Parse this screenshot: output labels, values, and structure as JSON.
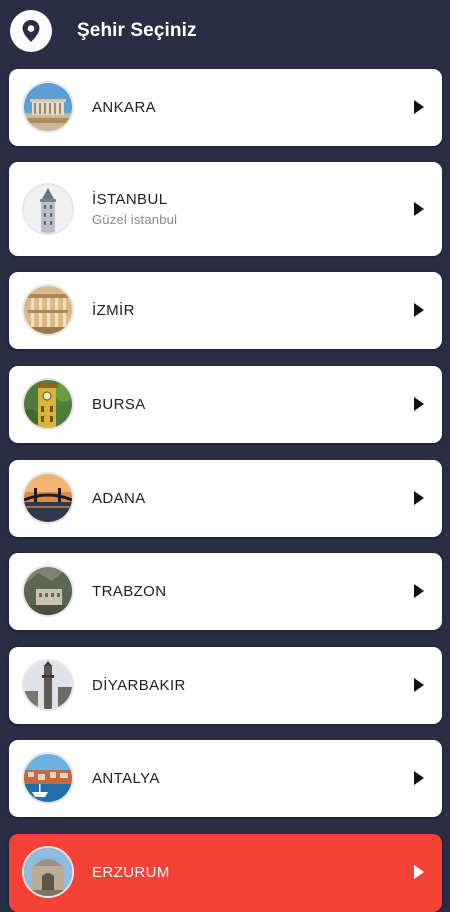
{
  "header": {
    "title": "Şehir Seçiniz",
    "icon": "location-pin-icon"
  },
  "cities": [
    {
      "name": "ANKARA",
      "subtitle": "",
      "thumbnail": "anitkabir",
      "selected": false
    },
    {
      "name": "İSTANBUL",
      "subtitle": "Güzel istanbul",
      "thumbnail": "galata-tower",
      "selected": false
    },
    {
      "name": "İZMİR",
      "subtitle": "",
      "thumbnail": "celsus-library",
      "selected": false
    },
    {
      "name": "BURSA",
      "subtitle": "",
      "thumbnail": "clock-tower",
      "selected": false
    },
    {
      "name": "ADANA",
      "subtitle": "",
      "thumbnail": "bridge-sunset",
      "selected": false
    },
    {
      "name": "TRABZON",
      "subtitle": "",
      "thumbnail": "monastery",
      "selected": false
    },
    {
      "name": "DİYARBAKIR",
      "subtitle": "",
      "thumbnail": "minaret",
      "selected": false
    },
    {
      "name": "ANTALYA",
      "subtitle": "",
      "thumbnail": "harbor",
      "selected": false
    },
    {
      "name": "ERZURUM",
      "subtitle": "",
      "thumbnail": "madrasa",
      "selected": true
    }
  ],
  "colors": {
    "background": "#2a2e45",
    "card": "#ffffff",
    "selected": "#f44336",
    "text": "#222222",
    "subtitle": "#8a8a8a"
  }
}
